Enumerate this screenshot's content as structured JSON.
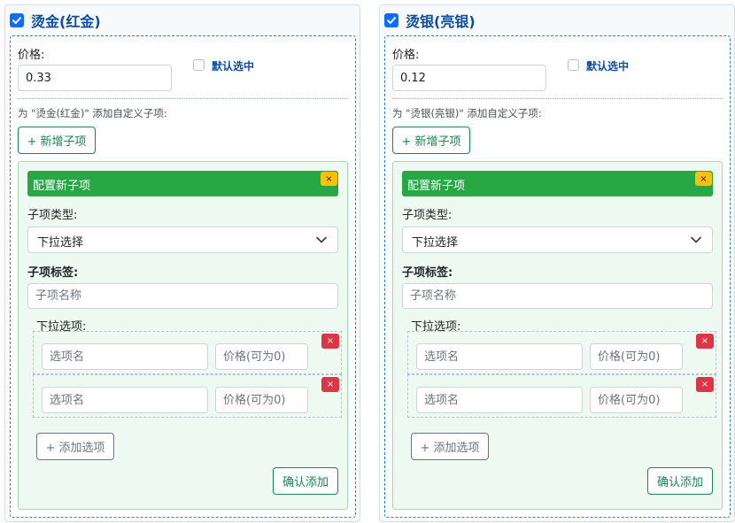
{
  "panels": [
    {
      "title": "烫金(红金)",
      "checked": true,
      "price_label": "价格:",
      "price_value": "0.33",
      "default_label": "默认选中",
      "hint": "为 \"烫金(红金)\" 添加自定义子项:",
      "add_sub_label": "+ 新增子项",
      "config": {
        "title": "配置新子项",
        "close": "×",
        "type_label": "子项类型:",
        "type_value": "下拉选择",
        "sub_label": "子项标签:",
        "sub_placeholder": "子项名称",
        "options_label": "下拉选项:",
        "options": [
          {
            "name_placeholder": "选项名",
            "price_placeholder": "价格(可为0)",
            "remove": "×"
          },
          {
            "name_placeholder": "选项名",
            "price_placeholder": "价格(可为0)",
            "remove": "×"
          }
        ],
        "add_option_label": "+ 添加选项",
        "confirm_label": "确认添加"
      }
    },
    {
      "title": "烫银(亮银)",
      "checked": true,
      "price_label": "价格:",
      "price_value": "0.12",
      "default_label": "默认选中",
      "hint": "为 \"烫银(亮银)\" 添加自定义子项:",
      "add_sub_label": "+ 新增子项",
      "config": {
        "title": "配置新子项",
        "close": "×",
        "type_label": "子项类型:",
        "type_value": "下拉选择",
        "sub_label": "子项标签:",
        "sub_placeholder": "子项名称",
        "options_label": "下拉选项:",
        "options": [
          {
            "name_placeholder": "选项名",
            "price_placeholder": "价格(可为0)",
            "remove": "×"
          },
          {
            "name_placeholder": "选项名",
            "price_placeholder": "价格(可为0)",
            "remove": "×"
          }
        ],
        "add_option_label": "+ 添加选项",
        "confirm_label": "确认添加"
      }
    }
  ],
  "colors": {
    "primary": "#0d6efd",
    "title_blue": "#0d4f9e",
    "success": "#28a745",
    "outline_success": "#198754",
    "warning": "#ffc107",
    "danger": "#dc3545"
  },
  "icons": {
    "panel_check": "check-icon",
    "select_arrow": "chevron-down-icon",
    "close": "close-icon"
  }
}
